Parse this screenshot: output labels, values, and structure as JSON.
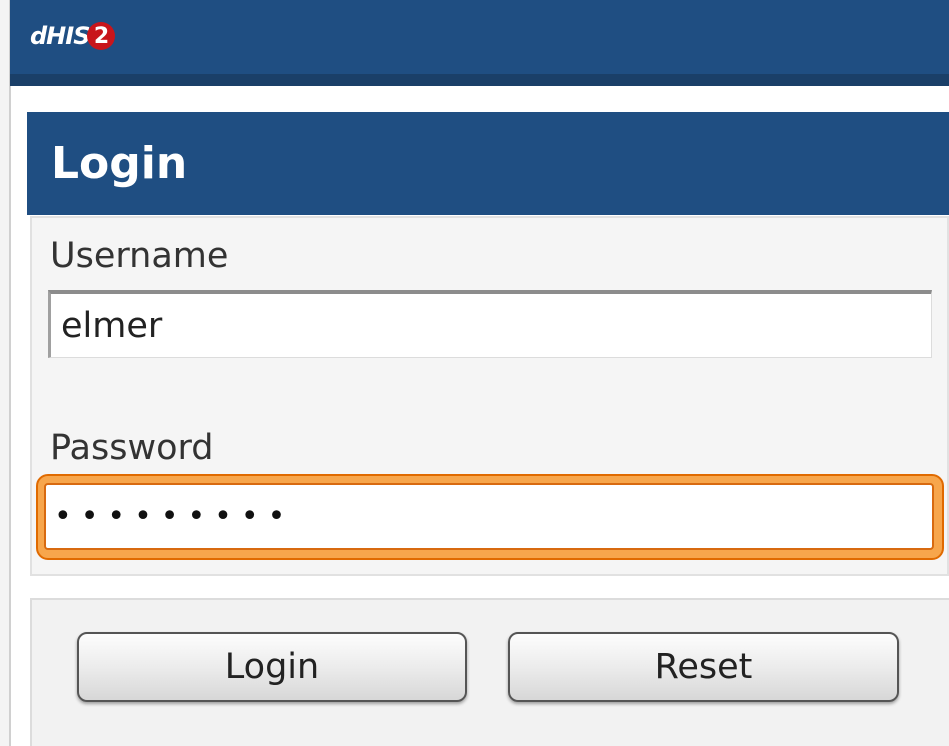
{
  "header": {
    "logo_text": "dHIS",
    "logo_badge": "2"
  },
  "login_panel": {
    "title": "Login"
  },
  "form": {
    "username_label": "Username",
    "username_value": "elmer",
    "password_label": "Password",
    "password_mask": "•••••••••",
    "focus_color": "#e06a00"
  },
  "buttons": {
    "login_label": "Login",
    "reset_label": "Reset"
  },
  "colors": {
    "brand_blue": "#1f4e82",
    "logo_red": "#c8151b"
  }
}
